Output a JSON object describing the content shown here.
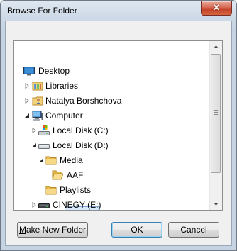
{
  "window": {
    "title": "Browse For Folder",
    "close_glyph": "✕"
  },
  "tree": {
    "items": [
      {
        "label": "Desktop",
        "icon": "desktop-icon",
        "expander": "none"
      },
      {
        "label": "Libraries",
        "icon": "libraries-icon",
        "expander": "collapsed"
      },
      {
        "label": "Natalya Borshchova",
        "icon": "user-folder-icon",
        "expander": "collapsed"
      },
      {
        "label": "Computer",
        "icon": "computer-icon",
        "expander": "expanded"
      },
      {
        "label": "Local Disk (C:)",
        "icon": "system-drive-icon",
        "expander": "collapsed"
      },
      {
        "label": "Local Disk (D:)",
        "icon": "drive-icon",
        "expander": "expanded"
      },
      {
        "label": "Media",
        "icon": "folder-icon",
        "expander": "expanded"
      },
      {
        "label": "AAF",
        "icon": "folder-open-icon",
        "expander": "none",
        "selected": true
      },
      {
        "label": "Playlists",
        "icon": "folder-icon",
        "expander": "none"
      },
      {
        "label": "CINEGY (E:)",
        "icon": "drive-icon",
        "expander": "collapsed"
      }
    ]
  },
  "buttons": {
    "make_new_folder": {
      "label_underlined": "M",
      "label_rest": "ake New Folder"
    },
    "ok": "OK",
    "cancel": "Cancel"
  },
  "colors": {
    "selection_fill": "#c1dcfc",
    "selection_border": "#7da2ce",
    "folder_yellow": "#f3d27a"
  }
}
